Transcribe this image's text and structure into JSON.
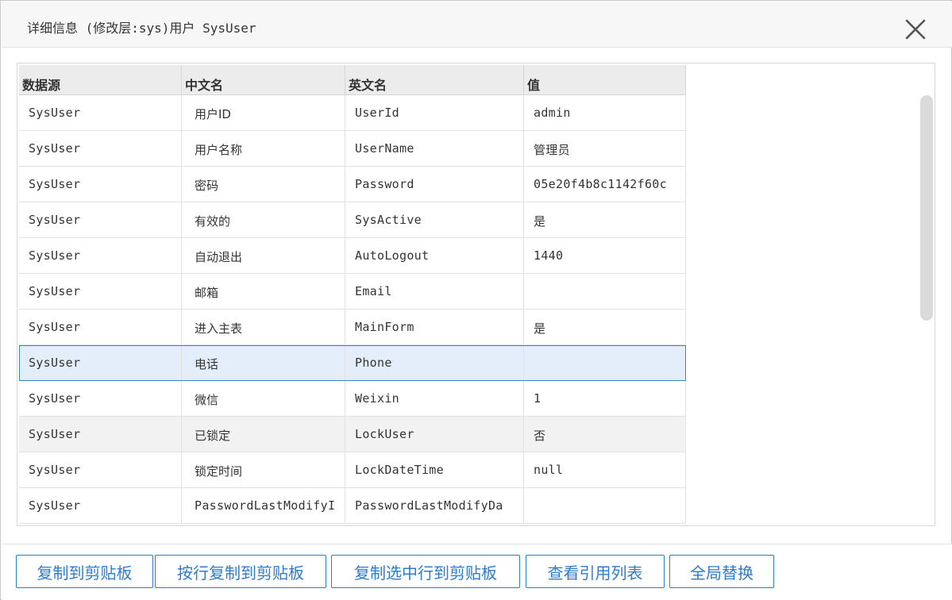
{
  "dialog": {
    "title": "详细信息 (修改层:sys)用户 SysUser"
  },
  "icons": {
    "close": "close-x-icon"
  },
  "table": {
    "headers": [
      "数据源",
      "中文名",
      "英文名",
      "值"
    ],
    "rows": [
      {
        "source": "SysUser",
        "cn": "用户ID",
        "en": "UserId",
        "value": "admin"
      },
      {
        "source": "SysUser",
        "cn": "用户名称",
        "en": "UserName",
        "value": "管理员"
      },
      {
        "source": "SysUser",
        "cn": "密码",
        "en": "Password",
        "value": "05e20f4b8c1142f60c"
      },
      {
        "source": "SysUser",
        "cn": "有效的",
        "en": "SysActive",
        "value": "是"
      },
      {
        "source": "SysUser",
        "cn": "自动退出",
        "en": "AutoLogout",
        "value": "1440"
      },
      {
        "source": "SysUser",
        "cn": "邮箱",
        "en": "Email",
        "value": ""
      },
      {
        "source": "SysUser",
        "cn": "进入主表",
        "en": "MainForm",
        "value": "是"
      },
      {
        "source": "SysUser",
        "cn": "电话",
        "en": "Phone",
        "value": ""
      },
      {
        "source": "SysUser",
        "cn": "微信",
        "en": "Weixin",
        "value": "1"
      },
      {
        "source": "SysUser",
        "cn": "已锁定",
        "en": "LockUser",
        "value": "否"
      },
      {
        "source": "SysUser",
        "cn": "锁定时间",
        "en": "LockDateTime",
        "value": "null"
      },
      {
        "source": "SysUser",
        "cn": "PasswordLastModifyI",
        "en": "PasswordLastModifyDa",
        "value": ""
      }
    ],
    "selected_row": "Phone"
  },
  "footer": {
    "copy_clipboard": "复制到剪贴板",
    "copy_by_row": "按行复制到剪贴板",
    "copy_selected": "复制选中行到剪贴板",
    "view_references": "查看引用列表",
    "global_replace": "全局替换"
  },
  "colors": {
    "accent": "#2e7bcf",
    "selected_row_bg": "#e4eefa",
    "header_bg": "#ececec"
  }
}
